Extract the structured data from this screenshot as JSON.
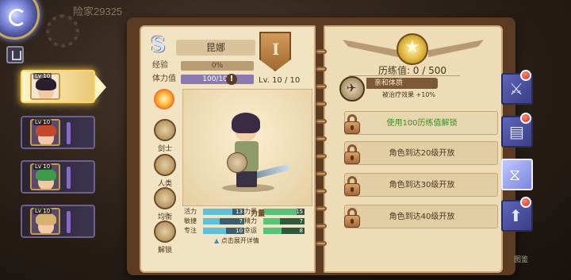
{
  "player": {
    "name": "险家29325"
  },
  "hero_list": [
    {
      "level": "Lv 10",
      "hair": "#2b1e2e",
      "bg": "#f3e6d0",
      "selected": true
    },
    {
      "level": "Lv 10",
      "hair": "#c4482c",
      "bg": "#5a4a6a",
      "selected": false
    },
    {
      "level": "Lv 10",
      "hair": "#3e9a4a",
      "bg": "#5a4a6a",
      "selected": false
    },
    {
      "level": "Lv 10",
      "hair": "#d8b070",
      "bg": "#5a4a6a",
      "selected": false
    }
  ],
  "hero": {
    "rank": "S",
    "name": "昆娜",
    "class_badge": "I",
    "exp_label": "经验",
    "exp_value": "0%",
    "exp_progress": 0,
    "stamina_label": "体力值",
    "stamina_value": "100/100",
    "stamina_progress": 1.0,
    "level_text": "Lv. 10 / 10"
  },
  "roles": [
    {
      "label": "剑士",
      "icon": "helmet-icon"
    },
    {
      "label": "人类",
      "icon": "armor-icon"
    },
    {
      "label": "均衡",
      "icon": "scale-icon"
    },
    {
      "label": "解锁",
      "icon": "scroll-icon"
    }
  ],
  "attributes": {
    "total_label": "力量",
    "left": [
      {
        "label": "活力",
        "value": "13",
        "fill": 0.72
      },
      {
        "label": "敏捷",
        "value": "7",
        "fill": 0.4
      },
      {
        "label": "专注",
        "value": "10",
        "fill": 0.55
      }
    ],
    "right": [
      {
        "label": "力量",
        "value": "15",
        "fill": 0.8
      },
      {
        "label": "精力",
        "value": "7",
        "fill": 0.4
      },
      {
        "label": "幸运",
        "value": "8",
        "fill": 0.45
      }
    ],
    "expand_hint": "点击展开详情"
  },
  "training": {
    "title": "历练值: 0 / 500",
    "skill_name": "亲和体质",
    "skill_desc": "被治疗效果 +10%",
    "unlocks": [
      {
        "text": "使用100历练值解锁",
        "primary": true
      },
      {
        "text": "角色到达20级开放",
        "primary": false
      },
      {
        "text": "角色到达30级开放",
        "primary": false
      },
      {
        "text": "角色到达40级开放",
        "primary": false
      }
    ]
  },
  "side_tabs": [
    {
      "icon": "sword-icon",
      "glyph": "⚔",
      "active": false,
      "badge": true
    },
    {
      "icon": "book-icon",
      "glyph": "▤",
      "active": false,
      "badge": true
    },
    {
      "icon": "hourglass-icon",
      "glyph": "⧖",
      "active": true,
      "badge": false
    },
    {
      "icon": "upgrade-arrow-icon",
      "glyph": "⬆",
      "active": false,
      "badge": true
    }
  ],
  "bottom_label": "图鉴"
}
